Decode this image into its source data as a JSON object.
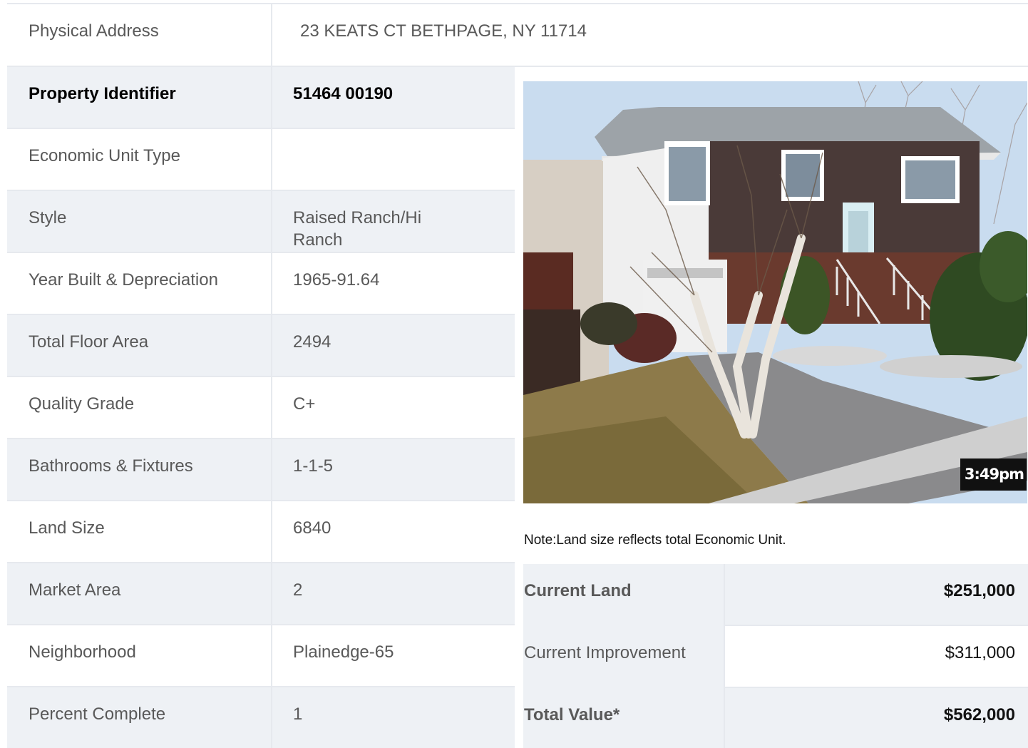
{
  "address": {
    "label": "Physical Address",
    "value": "23  KEATS CT  BETHPAGE, NY  11714"
  },
  "details": [
    {
      "label": "Property Identifier",
      "value": "51464  00190",
      "bold": true
    },
    {
      "label": "Economic Unit Type",
      "value": ""
    },
    {
      "label": "Style",
      "value": "Raised Ranch/Hi Ranch"
    },
    {
      "label": "Year Built & Depreciation",
      "value": "1965-91.64"
    },
    {
      "label": "Total Floor Area",
      "value": "2494"
    },
    {
      "label": "Quality Grade",
      "value": "C+"
    },
    {
      "label": "Bathrooms & Fixtures",
      "value": "1-1-5"
    },
    {
      "label": "Land Size",
      "value": "6840"
    },
    {
      "label": "Market Area",
      "value": "2"
    },
    {
      "label": "Neighborhood",
      "value": "Plainedge-65"
    },
    {
      "label": "Percent Complete",
      "value": "1"
    }
  ],
  "photo": {
    "timestamp": "3:49pm"
  },
  "note": "Note:Land size reflects total Economic Unit.",
  "values": [
    {
      "label": "Current Land",
      "amount": "$251,000",
      "bold": true
    },
    {
      "label": "Current Improvement",
      "amount": "$311,000",
      "bold": false
    },
    {
      "label": "Total Value*",
      "amount": "$562,000",
      "bold": true
    }
  ],
  "colors": {
    "row_shade": "#eef1f5",
    "border": "#e6e9ee",
    "text": "#595959"
  }
}
